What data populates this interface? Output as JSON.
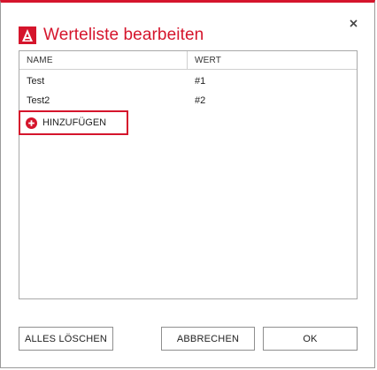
{
  "dialog": {
    "title": "Werteliste bearbeiten",
    "accent_color": "#d5152c",
    "logo_icon": "app-logo-icon",
    "close_icon": "close-icon"
  },
  "table": {
    "columns": [
      "NAME",
      "WERT"
    ],
    "rows": [
      {
        "name": "Test",
        "value": "#1"
      },
      {
        "name": "Test2",
        "value": "#2"
      }
    ],
    "add_label": "HINZUFÜGEN"
  },
  "footer": {
    "clear_all_label": "ALLES LÖSCHEN",
    "cancel_label": "ABBRECHEN",
    "ok_label": "OK"
  }
}
